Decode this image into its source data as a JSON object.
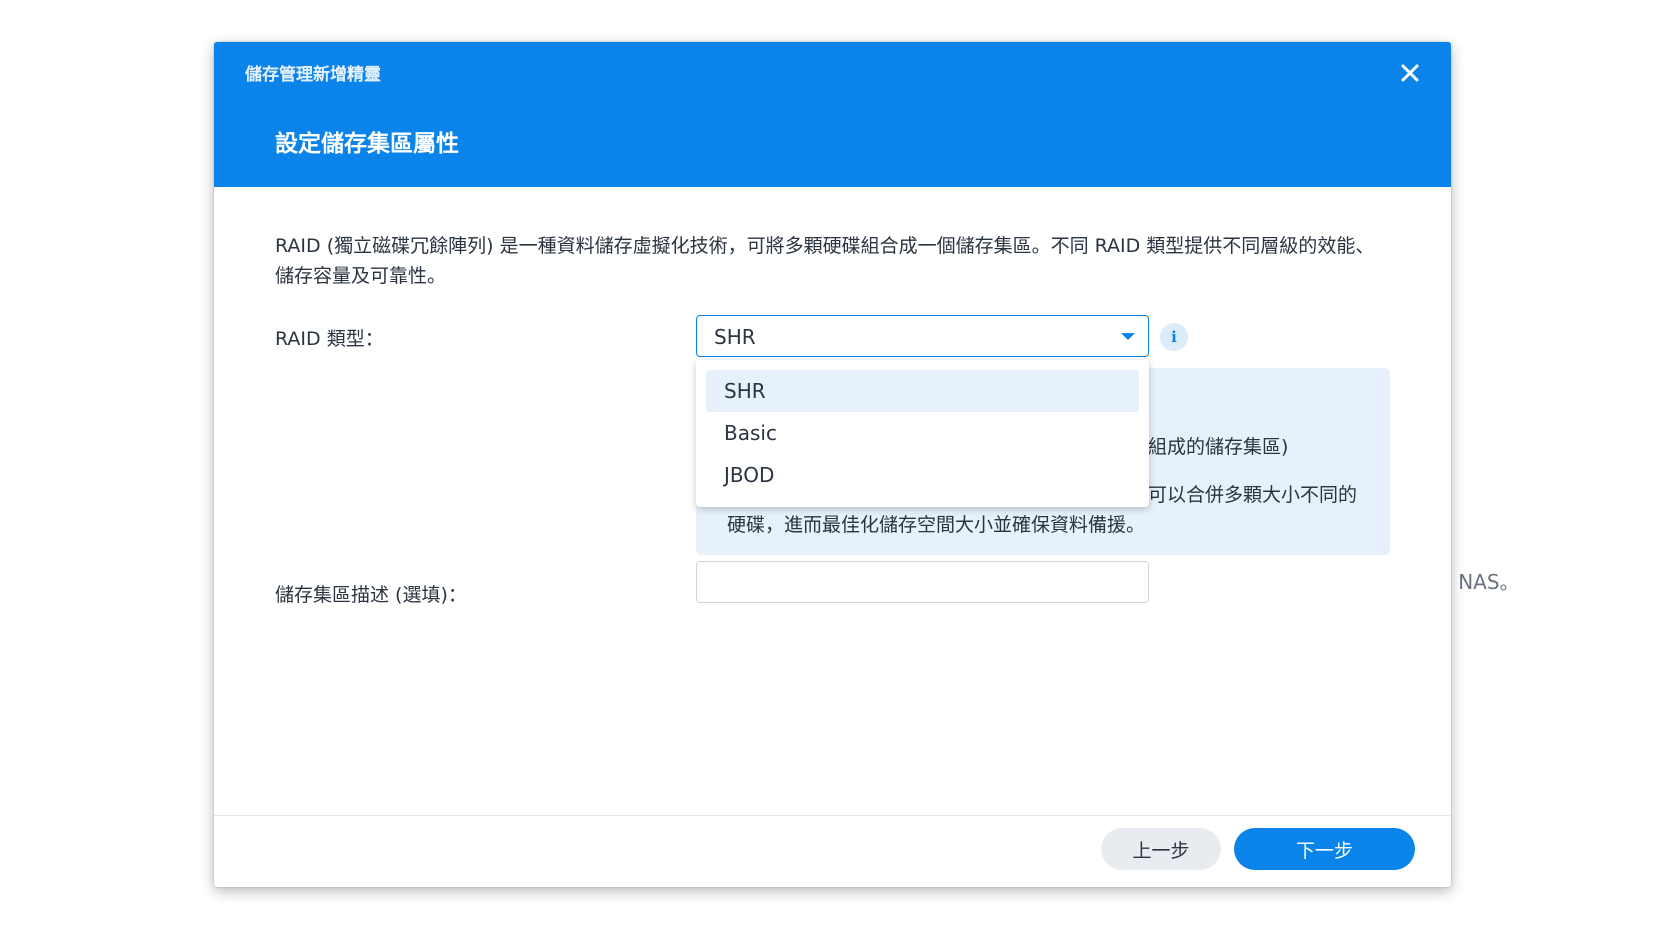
{
  "background": {
    "partial_text": "y NAS。"
  },
  "dialog": {
    "window_title": "儲存管理新增精靈",
    "step_title": "設定儲存集區屬性",
    "description": "RAID (獨立磁碟冗餘陣列) 是一種資料儲存虛擬化技術，可將多顆硬碟組合成一個儲存集區。不同 RAID 類型提供不同層級的效能、儲存容量及可靠性。",
    "raid_type": {
      "label": "RAID 類型：",
      "selected": "SHR",
      "options": [
        "SHR",
        "Basic",
        "JBOD"
      ]
    },
    "info_panel": {
      "line1_partial": "組成的儲存集區)",
      "line2_partial": "可以合併多顆大小不同的",
      "line3": "硬碟，進而最佳化儲存空間大小並確保資料備援。"
    },
    "pool_description": {
      "label": "儲存集區描述 (選填)：",
      "value": "",
      "placeholder": ""
    },
    "footer": {
      "back_label": "上一步",
      "next_label": "下一步"
    }
  },
  "colors": {
    "accent": "#0a84ea",
    "header_bg": "#0a84ea",
    "info_bg": "#e6f1fc",
    "text": "#2b3441"
  },
  "icons": {
    "close": "close-icon",
    "info": "info-icon",
    "dropdown": "chevron-down-icon"
  }
}
